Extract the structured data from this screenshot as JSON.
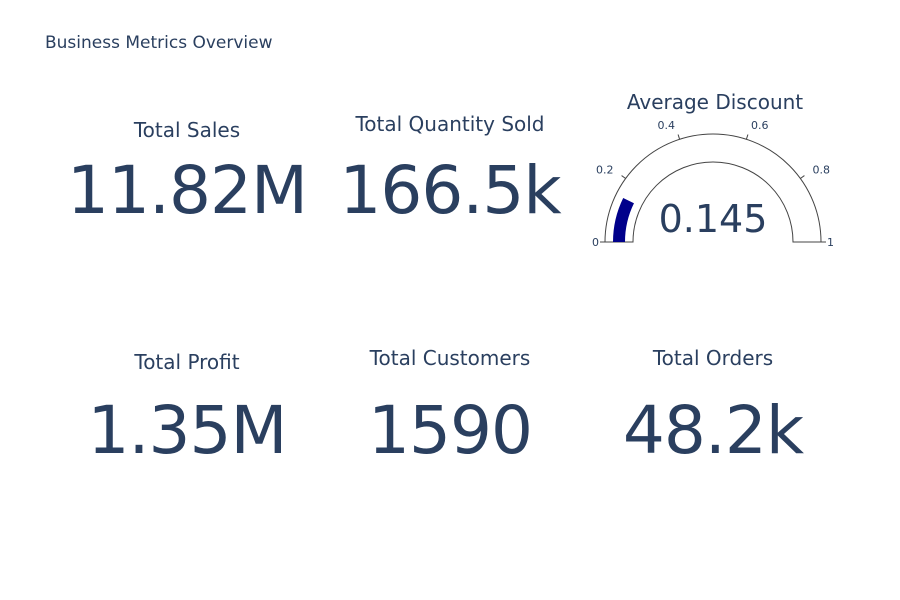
{
  "page": {
    "title": "Business Metrics Overview"
  },
  "chart_data": [
    {
      "type": "indicator",
      "mode": "number",
      "title": "Total Sales",
      "value_display": "11.82M"
    },
    {
      "type": "indicator",
      "mode": "number",
      "title": "Total Quantity Sold",
      "value_display": "166.5k"
    },
    {
      "type": "gauge",
      "mode": "gauge+number",
      "title": "Average Discount",
      "value": 0.145,
      "value_display": "0.145",
      "range": [
        0,
        1
      ],
      "ticks": [
        0,
        0.2,
        0.4,
        0.6,
        0.8,
        1
      ],
      "tick_labels": [
        "0",
        "0.2",
        "0.4",
        "0.6",
        "0.8",
        "1"
      ],
      "bar_color": "#00008b",
      "outline_color": "#444444"
    },
    {
      "type": "indicator",
      "mode": "number",
      "title": "Total Profit",
      "value_display": "1.35M"
    },
    {
      "type": "indicator",
      "mode": "number",
      "title": "Total Customers",
      "value_display": "1590"
    },
    {
      "type": "indicator",
      "mode": "number",
      "title": "Total Orders",
      "value_display": "48.2k"
    }
  ],
  "colors": {
    "text": "#2a3f5f",
    "gauge_bar": "#00008b",
    "gauge_outline": "#444444"
  }
}
